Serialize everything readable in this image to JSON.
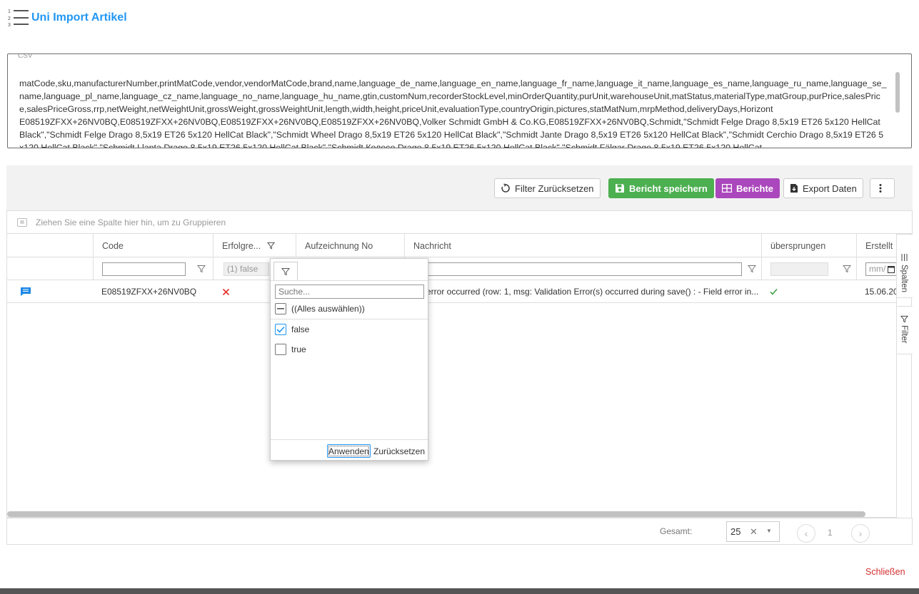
{
  "page": {
    "title": "Uni Import Artikel"
  },
  "csv": {
    "label": "CSV",
    "text": "matCode,sku,manufacturerNumber,printMatCode,vendor,vendorMatCode,brand,name,language_de_name,language_en_name,language_fr_name,language_it_name,language_es_name,language_ru_name,language_se_name,language_pl_name,language_cz_name,language_no_name,language_hu_name,gtin,customNum,recorderStockLevel,minOrderQuantity,purUnit,warehouseUnit,matStatus,materialType,matGroup,purPrice,salesPrice,salesPriceGross,rrp,netWeight,netWeightUnit,grossWeight,grossWeightUnit,length,width,height,priceUnit,evaluationType,countryOrigin,pictures,statMatNum,mrpMethod,deliveryDays,Horizont\nE08519ZFXX+26NV0BQ,E08519ZFXX+26NV0BQ,E08519ZFXX+26NV0BQ,E08519ZFXX+26NV0BQ,Volker Schmidt GmbH & Co.KG,E08519ZFXX+26NV0BQ,Schmidt,\"Schmidt Felge Drago 8,5x19 ET26 5x120 HellCat Black\",\"Schmidt Felge Drago 8,5x19 ET26 5x120 HellCat Black\",\"Schmidt Wheel Drago 8,5x19 ET26 5x120 HellCat Black\",\"Schmidt Jante Drago 8,5x19 ET26 5x120 HellCat Black\",\"Schmidt Cerchio Drago 8,5x19 ET26 5x120 HellCat Black\",\"Schmidt Llanta Drago 8,5x19 ET26 5x120 HellCat Black\",\"Schmidt Колесо Drago 8,5x19 ET26 5x120 HellCat Black\",\"Schmidt Fälgar Drago 8,5x19 ET26 5x120 HellCat"
  },
  "toolbar": {
    "reset_filter": "Filter Zurücksetzen",
    "save_report": "Bericht speichern",
    "reports": "Berichte",
    "export": "Export Daten"
  },
  "grid": {
    "group_hint": "Ziehen Sie eine Spalte hier hin, um zu Gruppieren",
    "columns": {
      "code": "Code",
      "erfolg": "Erfolgre...",
      "aufzeichnung": "Aufzeichnung No",
      "nachricht": "Nachricht",
      "uebersprungen": "übersprungen",
      "erstellt": "Erstellt"
    },
    "filter_erfolg": "(1) false",
    "filter_date_placeholder": "mm/",
    "row": {
      "code": "E08519ZFXX+26NV0BQ",
      "message": "error occurred (row: 1, msg: Validation Error(s) occurred during save() : - Field error in...",
      "created": "15.06.20"
    },
    "side_tabs": {
      "columns": "Spalten",
      "filter": "Filter"
    },
    "footer": {
      "total_label": "Gesamt:",
      "page_size": "25",
      "page_number": "1"
    }
  },
  "filter_popup": {
    "search_placeholder": "Suche...",
    "select_all": "((Alles auswählen))",
    "options": [
      "false",
      "true"
    ],
    "apply": "Anwenden",
    "reset": "Zurücksetzen"
  },
  "close": "Schließen",
  "colors": {
    "accent": "#2196f3",
    "green": "#4caf50",
    "purple": "#ab47bc",
    "error": "#e53935",
    "success": "#43a047",
    "close": "#d32f2f"
  }
}
